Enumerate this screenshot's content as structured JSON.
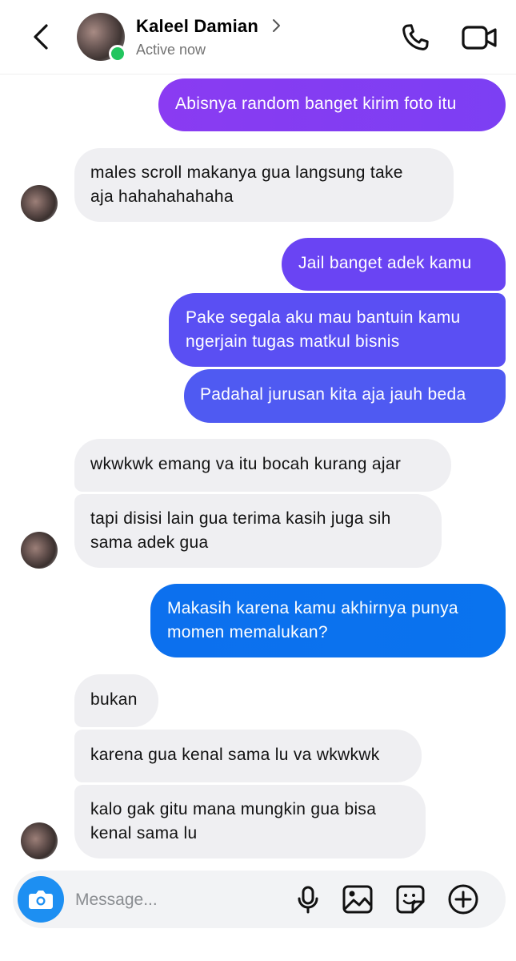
{
  "header": {
    "contact_name": "Kaleel Damian",
    "status": "Active now",
    "icons": [
      "back-arrow-icon",
      "chevron-right-icon",
      "phone-icon",
      "video-camera-icon"
    ]
  },
  "messages": [
    {
      "side": "out",
      "lines": [
        "Abisnya random banget kirim foto itu"
      ]
    },
    {
      "side": "in",
      "lines": [
        "males scroll makanya gua langsung take",
        "aja hahahahahaha"
      ]
    },
    {
      "side": "out",
      "lines": [
        "Jail banget adek kamu"
      ]
    },
    {
      "side": "out",
      "lines": [
        "Pake segala aku mau bantuin kamu",
        "ngerjain tugas matkul bisnis"
      ]
    },
    {
      "side": "out",
      "lines": [
        "Padahal jurusan kita aja jauh beda"
      ]
    },
    {
      "side": "in",
      "lines": [
        "wkwkwk emang va itu bocah kurang ajar"
      ]
    },
    {
      "side": "in",
      "lines": [
        "tapi disisi lain gua terima kasih juga sih",
        "sama adek gua"
      ]
    },
    {
      "side": "out",
      "lines": [
        "Makasih karena kamu akhirnya punya",
        "momen memalukan?"
      ]
    },
    {
      "side": "in",
      "lines": [
        "bukan"
      ]
    },
    {
      "side": "in",
      "lines": [
        "karena gua kenal sama lu va wkwkwk"
      ]
    },
    {
      "side": "in",
      "lines": [
        "kalo gak gitu mana mungkin gua bisa",
        "kenal sama lu"
      ]
    }
  ],
  "composer": {
    "placeholder": "Message...",
    "icons": [
      "camera-icon",
      "microphone-icon",
      "gallery-icon",
      "sticker-icon",
      "add-icon"
    ]
  },
  "colors": {
    "incoming_bubble": "#efeff2",
    "outgoing_gradient": [
      "#8a3bf2",
      "#6a44f3",
      "#4f5af2",
      "#0a73ee"
    ],
    "online": "#22c55e",
    "camera_button": "#1d8ff2"
  }
}
